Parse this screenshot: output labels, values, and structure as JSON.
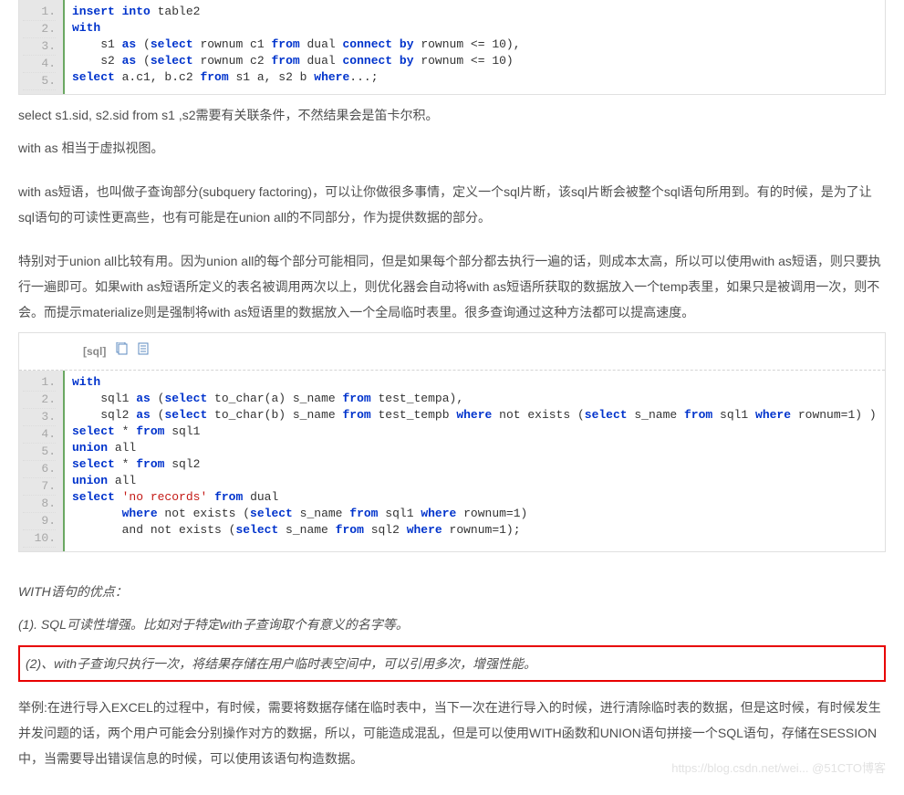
{
  "code1": {
    "lines": [
      {
        "parts": [
          {
            "t": "insert into",
            "c": "kw"
          },
          {
            "t": " table2",
            "c": "pln"
          }
        ]
      },
      {
        "parts": [
          {
            "t": "with",
            "c": "kw"
          }
        ]
      },
      {
        "parts": [
          {
            "t": "    s1 ",
            "c": "pln"
          },
          {
            "t": "as",
            "c": "kw"
          },
          {
            "t": " (",
            "c": "pln"
          },
          {
            "t": "select",
            "c": "kw"
          },
          {
            "t": " rownum c1 ",
            "c": "pln"
          },
          {
            "t": "from",
            "c": "kw"
          },
          {
            "t": " dual ",
            "c": "pln"
          },
          {
            "t": "connect by",
            "c": "kw"
          },
          {
            "t": " rownum <= 10),",
            "c": "pln"
          }
        ]
      },
      {
        "parts": [
          {
            "t": "    s2 ",
            "c": "pln"
          },
          {
            "t": "as",
            "c": "kw"
          },
          {
            "t": " (",
            "c": "pln"
          },
          {
            "t": "select",
            "c": "kw"
          },
          {
            "t": " rownum c2 ",
            "c": "pln"
          },
          {
            "t": "from",
            "c": "kw"
          },
          {
            "t": " dual ",
            "c": "pln"
          },
          {
            "t": "connect by",
            "c": "kw"
          },
          {
            "t": " rownum <= 10)",
            "c": "pln"
          }
        ]
      },
      {
        "parts": [
          {
            "t": "select",
            "c": "kw"
          },
          {
            "t": " a.c1, b.c2 ",
            "c": "pln"
          },
          {
            "t": "from",
            "c": "kw"
          },
          {
            "t": " s1 a, s2 b ",
            "c": "pln"
          },
          {
            "t": "where",
            "c": "kw"
          },
          {
            "t": "...;",
            "c": "pln"
          }
        ]
      }
    ]
  },
  "para1": "select s1.sid, s2.sid from s1 ,s2需要有关联条件，不然结果会是笛卡尔积。",
  "para2": "with as 相当于虚拟视图。",
  "para3": "with as短语，也叫做子查询部分(subquery factoring)，可以让你做很多事情，定义一个sql片断，该sql片断会被整个sql语句所用到。有的时候，是为了让sql语句的可读性更高些，也有可能是在union all的不同部分，作为提供数据的部分。",
  "para4": "特别对于union all比较有用。因为union all的每个部分可能相同，但是如果每个部分都去执行一遍的话，则成本太高，所以可以使用with as短语，则只要执行一遍即可。如果with as短语所定义的表名被调用两次以上，则优化器会自动将with as短语所获取的数据放入一个temp表里，如果只是被调用一次，则不会。而提示materialize则是强制将with as短语里的数据放入一个全局临时表里。很多查询通过这种方法都可以提高速度。",
  "code2": {
    "langTag": "[sql]",
    "lines": [
      {
        "parts": [
          {
            "t": "with",
            "c": "kw"
          }
        ]
      },
      {
        "parts": [
          {
            "t": "    sql1 ",
            "c": "pln"
          },
          {
            "t": "as",
            "c": "kw"
          },
          {
            "t": " (",
            "c": "pln"
          },
          {
            "t": "select",
            "c": "kw"
          },
          {
            "t": " to_char(a) s_name ",
            "c": "pln"
          },
          {
            "t": "from",
            "c": "kw"
          },
          {
            "t": " test_tempa),",
            "c": "pln"
          }
        ]
      },
      {
        "parts": [
          {
            "t": "    sql2 ",
            "c": "pln"
          },
          {
            "t": "as",
            "c": "kw"
          },
          {
            "t": " (",
            "c": "pln"
          },
          {
            "t": "select",
            "c": "kw"
          },
          {
            "t": " to_char(b) s_name ",
            "c": "pln"
          },
          {
            "t": "from",
            "c": "kw"
          },
          {
            "t": " test_tempb ",
            "c": "pln"
          },
          {
            "t": "where",
            "c": "kw"
          },
          {
            "t": " not exists (",
            "c": "pln"
          },
          {
            "t": "select",
            "c": "kw"
          },
          {
            "t": " s_name ",
            "c": "pln"
          },
          {
            "t": "from",
            "c": "kw"
          },
          {
            "t": " sql1 ",
            "c": "pln"
          },
          {
            "t": "where",
            "c": "kw"
          },
          {
            "t": " rownum=1) )",
            "c": "pln"
          }
        ]
      },
      {
        "parts": [
          {
            "t": "select",
            "c": "kw"
          },
          {
            "t": " * ",
            "c": "pln"
          },
          {
            "t": "from",
            "c": "kw"
          },
          {
            "t": " sql1",
            "c": "pln"
          }
        ]
      },
      {
        "parts": [
          {
            "t": "union",
            "c": "kw"
          },
          {
            "t": " all",
            "c": "pln"
          }
        ]
      },
      {
        "parts": [
          {
            "t": "select",
            "c": "kw"
          },
          {
            "t": " * ",
            "c": "pln"
          },
          {
            "t": "from",
            "c": "kw"
          },
          {
            "t": " sql2",
            "c": "pln"
          }
        ]
      },
      {
        "parts": [
          {
            "t": "union",
            "c": "kw"
          },
          {
            "t": " all",
            "c": "pln"
          }
        ]
      },
      {
        "parts": [
          {
            "t": "select",
            "c": "kw"
          },
          {
            "t": " ",
            "c": "pln"
          },
          {
            "t": "'no records'",
            "c": "str"
          },
          {
            "t": " ",
            "c": "pln"
          },
          {
            "t": "from",
            "c": "kw"
          },
          {
            "t": " dual",
            "c": "pln"
          }
        ]
      },
      {
        "parts": [
          {
            "t": "       ",
            "c": "pln"
          },
          {
            "t": "where",
            "c": "kw"
          },
          {
            "t": " not exists (",
            "c": "pln"
          },
          {
            "t": "select",
            "c": "kw"
          },
          {
            "t": " s_name ",
            "c": "pln"
          },
          {
            "t": "from",
            "c": "kw"
          },
          {
            "t": " sql1 ",
            "c": "pln"
          },
          {
            "t": "where",
            "c": "kw"
          },
          {
            "t": " rownum=1)",
            "c": "pln"
          }
        ]
      },
      {
        "parts": [
          {
            "t": "       and not exists (",
            "c": "pln"
          },
          {
            "t": "select",
            "c": "kw"
          },
          {
            "t": " s_name ",
            "c": "pln"
          },
          {
            "t": "from",
            "c": "kw"
          },
          {
            "t": " sql2 ",
            "c": "pln"
          },
          {
            "t": "where",
            "c": "kw"
          },
          {
            "t": " rownum=1);",
            "c": "pln"
          }
        ]
      }
    ]
  },
  "ital1": "WITH语句的优点：",
  "ital2": "(1). SQL可读性增强。比如对于特定with子查询取个有意义的名字等。",
  "ital3": "(2)、with子查询只执行一次，将结果存储在用户临时表空间中，可以引用多次，增强性能。",
  "para5": "举例:在进行导入EXCEL的过程中，有时候，需要将数据存储在临时表中，当下一次在进行导入的时候，进行清除临时表的数据，但是这时候，有时候发生并发问题的话，两个用户可能会分别操作对方的数据，所以，可能造成混乱，但是可以使用WITH函数和UNION语句拼接一个SQL语句，存储在SESSION中，当需要导出错误信息的时候，可以使用该语句构造数据。",
  "watermark": "https://blog.csdn.net/wei... @51CTO博客"
}
